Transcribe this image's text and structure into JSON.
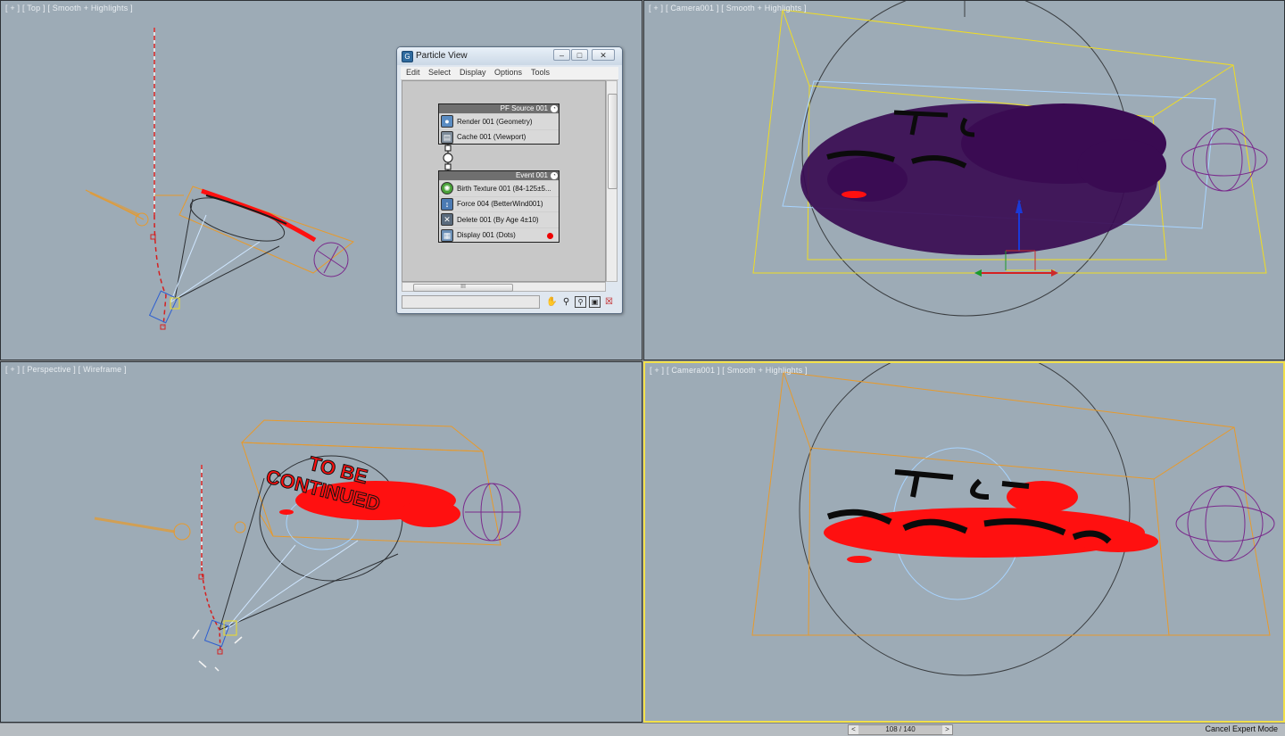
{
  "viewports": {
    "top_left_label": "[ + ] [ Top ] [ Smooth + Highlights ]",
    "top_right_label": "[ + ] [ Camera001 ] [ Smooth + Highlights ]",
    "bottom_left_label": "[ + ] [ Perspective ] [ Wireframe ]",
    "bottom_right_label": "[ + ] [ Camera001 ] [ Smooth + Highlights ]",
    "axis_z": "Z",
    "scene_text_line1": "TO BE",
    "scene_text_line2": "CONTINUED"
  },
  "particle_view": {
    "title": "Particle View",
    "menu": [
      "Edit",
      "Select",
      "Display",
      "Options",
      "Tools"
    ],
    "scroll_glyph": "III",
    "source_node": {
      "title": "PF Source 001",
      "operators": [
        "Render 001 (Geometry)",
        "Cache 001 (Viewport)"
      ]
    },
    "event_node": {
      "title": "Event 001",
      "operators": [
        "Birth Texture 001 (84-125±5...",
        "Force 004 (BetterWind001)",
        "Delete 001 (By Age 4±10)",
        "Display 001 (Dots)"
      ]
    }
  },
  "timeline": {
    "frame_counter": "108 / 140",
    "prev": "<",
    "next": ">"
  },
  "status": {
    "cancel_expert_mode": "Cancel Expert Mode"
  },
  "colors": {
    "viewport_bg": "#9dabb6",
    "active_border": "#f2e04a",
    "particles_red": "#ff1010",
    "particles_purple": "#3a0b52",
    "bounds_orange": "#e79a2c",
    "camera_yellow": "#f0dc22"
  },
  "icons": [
    "pan-icon",
    "zoom-icon",
    "zoom-region-icon",
    "zoom-extents-icon",
    "delete-view-icon"
  ]
}
